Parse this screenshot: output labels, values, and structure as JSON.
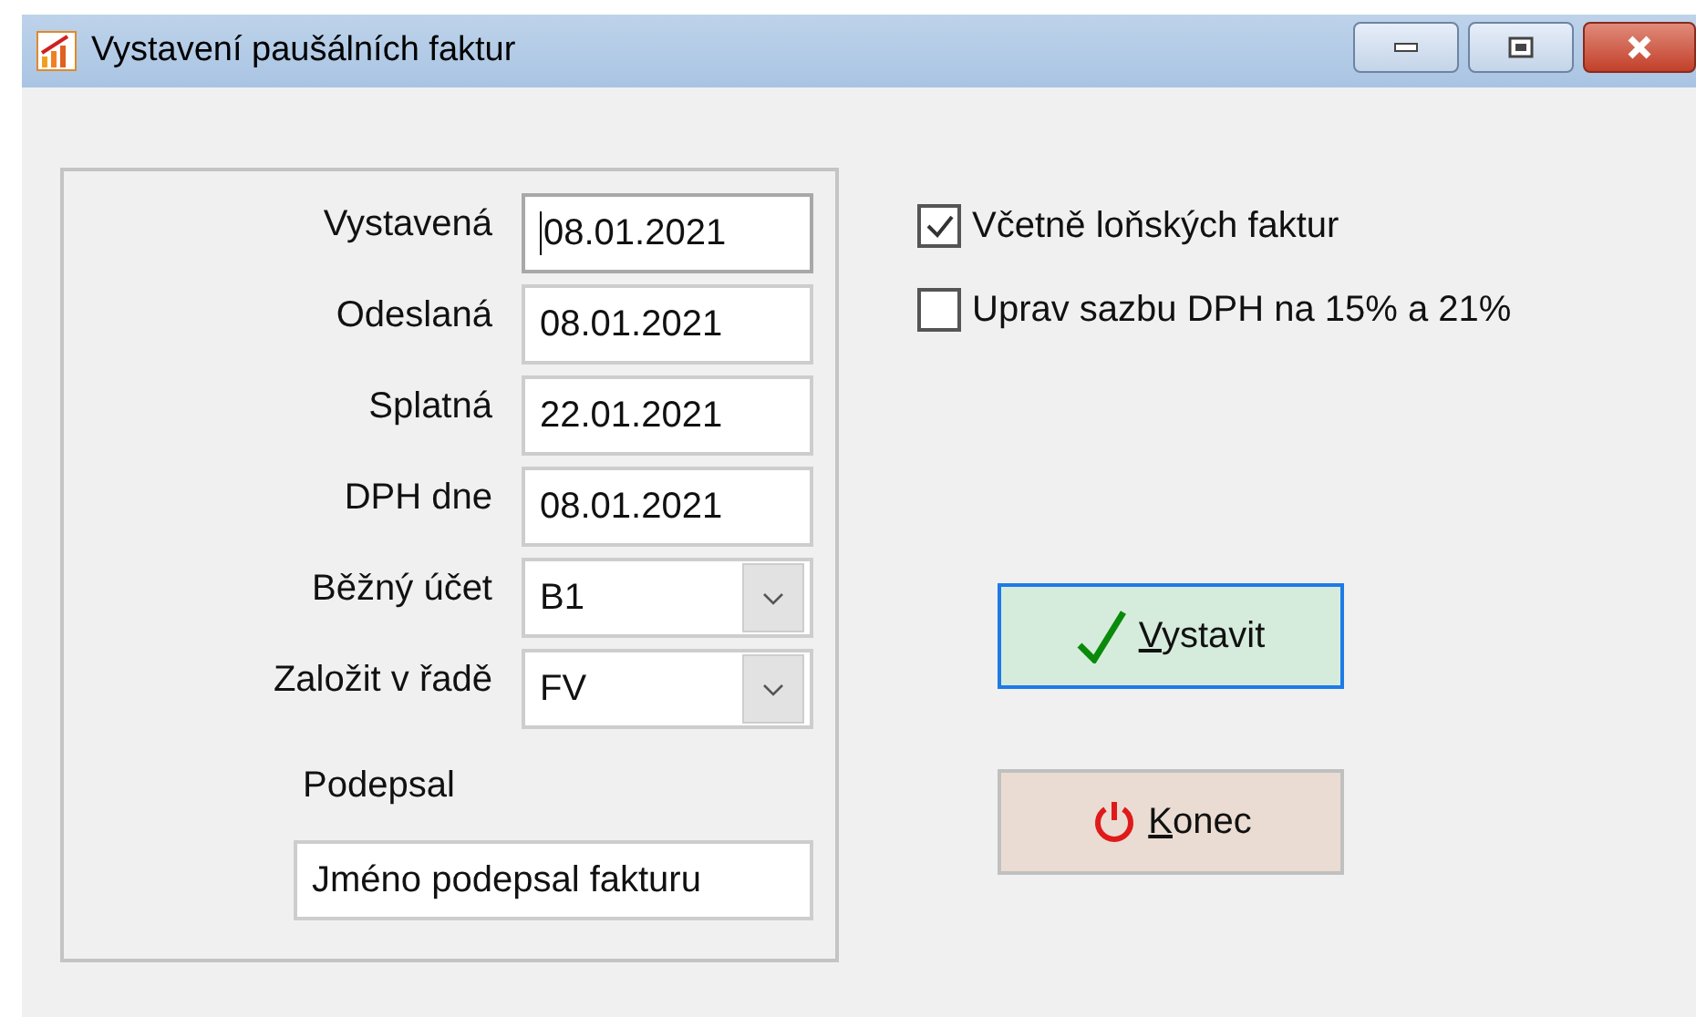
{
  "window": {
    "title": "Vystavení paušálních faktur"
  },
  "fields": [
    {
      "kind": "text",
      "label": "Vystavená",
      "value": "08.01.2021",
      "focused": true
    },
    {
      "kind": "text",
      "label": "Odeslaná",
      "value": "08.01.2021",
      "focused": false
    },
    {
      "kind": "text",
      "label": "Splatná",
      "value": "22.01.2021",
      "focused": false
    },
    {
      "kind": "text",
      "label": "DPH dne",
      "value": "08.01.2021",
      "focused": false
    },
    {
      "kind": "combo",
      "label": "Běžný účet",
      "value": "B1",
      "focused": false
    },
    {
      "kind": "combo",
      "label": "Založit v řadě",
      "value": "FV",
      "focused": false
    }
  ],
  "signature": {
    "label": "Podepsal",
    "value": "Jméno podepsal fakturu"
  },
  "options": [
    {
      "label": "Včetně loňských faktur",
      "checked": true
    },
    {
      "label": "Uprav sazbu DPH na 15% a 21%",
      "checked": false
    }
  ],
  "buttons": [
    {
      "kind": "confirm",
      "label": "Vystavit",
      "focused": true
    },
    {
      "kind": "exit",
      "label": "Konec",
      "focused": false
    }
  ]
}
